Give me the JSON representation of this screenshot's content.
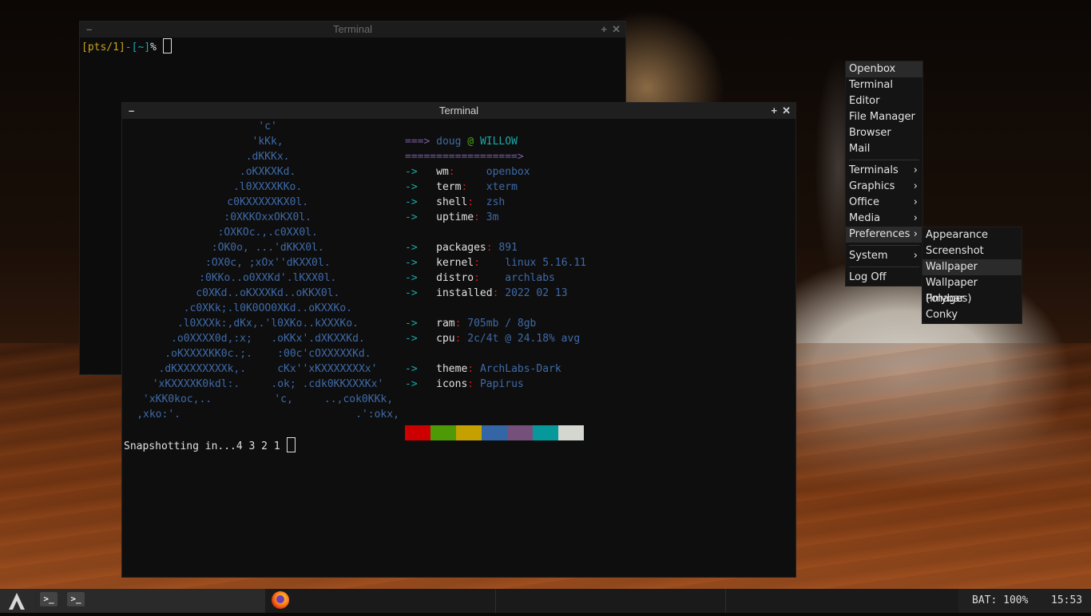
{
  "back_terminal": {
    "title": "Terminal",
    "prompt_a": "[pts/1]",
    "prompt_b": "-[~]",
    "prompt_c": "%"
  },
  "front_terminal": {
    "title": "Terminal",
    "art": [
      "'c'",
      "'kKk,",
      ".dKKKx.",
      ".oKXKXKd.",
      ".l0XXXXKKo.",
      "c0KXXXXXKX0l.",
      ":0XKKOxxOKX0l.",
      ":OXKOc.,.c0XX0l.",
      ":OK0o, ...'dKKX0l.",
      ":OX0c, ;xOx''dKXX0l.",
      ":0KKo..o0XXKd'.lKXX0l.",
      "c0XKd..oKXXXKd..oKKX0l.",
      ".c0XKk;.l0K0OO0XKd..oKXXKo.",
      ".l0XXXk:,dKx,.'l0XKo..kXXXKo.",
      ".o0XXXX0d,:x;   .oKKx'.dXKXXKd.",
      ".oKXXXXKK0c.;.    :00c'cOXXXXXKd.",
      ".dKXXXXXXXXk,.     cKx''xKXXXXXXXx'",
      "'xKXXXXK0kdl:.     .ok; .cdk0KKXXXKx'",
      "'xKK0koc,..          'c,     ..,cok0KKk,",
      ",xko:'.                            .':okx,"
    ],
    "user_line": {
      "arrow": "===>",
      "user": "doug",
      "at": "@",
      "host": "WILLOW"
    },
    "divider": "==================>",
    "info_arrow": "->",
    "info": [
      {
        "key": "wm",
        "value": "openbox"
      },
      {
        "key": "term",
        "value": "xterm"
      },
      {
        "key": "shell",
        "value": "zsh"
      },
      {
        "key": "uptime",
        "value": "3m"
      },
      {
        "key": "packages",
        "value": "891"
      },
      {
        "key": "kernel",
        "value": "linux 5.16.11"
      },
      {
        "key": "distro",
        "value": "archlabs"
      },
      {
        "key": "installed",
        "value": "2022 02 13"
      },
      {
        "key": "ram",
        "value": "705mb / 8gb"
      },
      {
        "key": "cpu",
        "value": "2c/4t @ 24.18% avg"
      },
      {
        "key": "theme",
        "value": "ArchLabs-Dark"
      },
      {
        "key": "icons",
        "value": "Papirus"
      }
    ],
    "swatch_colors": [
      "#cc0000",
      "#4e9a06",
      "#c4a000",
      "#3465a4",
      "#75507b",
      "#06989a",
      "#d3d7cf"
    ],
    "snapshot_text": "Snapshotting in...4 3 2 1"
  },
  "menu": {
    "header": "Openbox",
    "items_top": [
      "Terminal",
      "Editor",
      "File Manager",
      "Browser",
      "Mail"
    ],
    "submenus": [
      "Terminals",
      "Graphics",
      "Office",
      "Media",
      "Preferences"
    ],
    "system": "System",
    "logoff": "Log Off",
    "preferences_sub": [
      "Appearance",
      "Screenshot",
      "Wallpaper",
      "Wallpaper (images)",
      "Polybar",
      "Conky"
    ]
  },
  "taskbar": {
    "battery": "BAT: 100%",
    "clock": "15:53",
    "task_glyph": ">_"
  },
  "colors": {
    "accent_yellow": "#c8a31a",
    "accent_cyan": "#1aa8a8",
    "accent_blue": "#3f6aa8",
    "accent_red": "#cc1b1b"
  }
}
